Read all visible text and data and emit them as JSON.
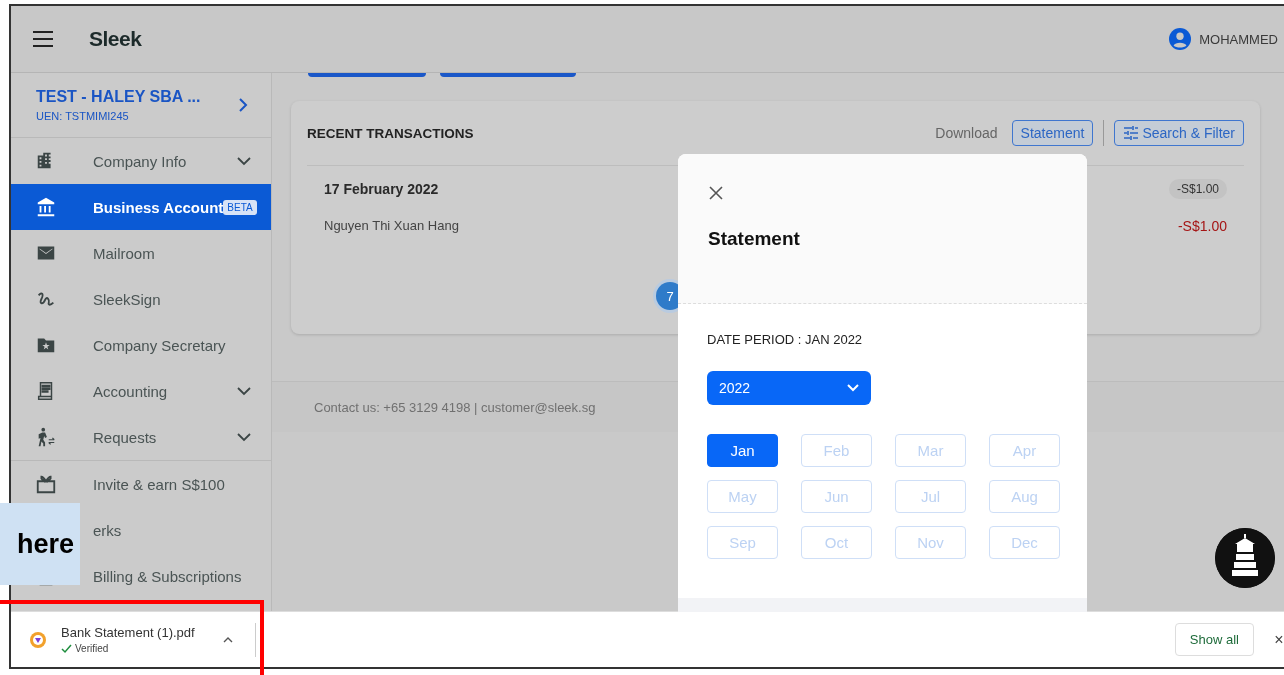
{
  "header": {
    "logo": "Sleek",
    "user": "MOHAMMED"
  },
  "company": {
    "name": "TEST - HALEY SBA ...",
    "uen": "UEN: TSTMIMI245"
  },
  "sidebar": {
    "items": [
      {
        "label": "Company Info",
        "expandable": true,
        "selected": false
      },
      {
        "label": "Business Account",
        "expandable": false,
        "selected": true,
        "badge": "BETA"
      },
      {
        "label": "Mailroom",
        "expandable": false,
        "selected": false
      },
      {
        "label": "SleekSign",
        "expandable": false,
        "selected": false
      },
      {
        "label": "Company Secretary",
        "expandable": false,
        "selected": false
      },
      {
        "label": "Accounting",
        "expandable": true,
        "selected": false
      },
      {
        "label": "Requests",
        "expandable": true,
        "selected": false
      }
    ],
    "extra_items": [
      {
        "label": "Invite & earn S$100",
        "selected": false
      },
      {
        "label": "erks",
        "selected": false
      },
      {
        "label": "Billing & Subscriptions",
        "selected": false
      }
    ]
  },
  "transactions": {
    "title": "RECENT TRANSACTIONS",
    "download_label": "Download",
    "statement_button": "Statement",
    "filter_button": "Search & Filter",
    "rows": [
      {
        "date": "17 February 2022",
        "total": "-S$1.00",
        "name": "Nguyen Thi Xuan Hang",
        "amount": "-S$1.00"
      }
    ],
    "page": "7"
  },
  "footer": {
    "contact": "Contact us: +65 3129 4198 | customer@sleek.sg"
  },
  "modal": {
    "title": "Statement",
    "period": "DATE PERIOD : JAN 2022",
    "year": "2022",
    "months": [
      {
        "label": "Jan",
        "selected": true,
        "disabled": false
      },
      {
        "label": "Feb",
        "selected": false,
        "disabled": true
      },
      {
        "label": "Mar",
        "selected": false,
        "disabled": true
      },
      {
        "label": "Apr",
        "selected": false,
        "disabled": true
      },
      {
        "label": "May",
        "selected": false,
        "disabled": true
      },
      {
        "label": "Jun",
        "selected": false,
        "disabled": true
      },
      {
        "label": "Jul",
        "selected": false,
        "disabled": true
      },
      {
        "label": "Aug",
        "selected": false,
        "disabled": true
      },
      {
        "label": "Sep",
        "selected": false,
        "disabled": true
      },
      {
        "label": "Oct",
        "selected": false,
        "disabled": true
      },
      {
        "label": "Nov",
        "selected": false,
        "disabled": true
      },
      {
        "label": "Dec",
        "selected": false,
        "disabled": true
      }
    ]
  },
  "download_bar": {
    "file": "Bank Statement (1).pdf",
    "status": "Verified",
    "show_all": "Show all",
    "close": "×"
  },
  "callout": {
    "text": "here"
  }
}
